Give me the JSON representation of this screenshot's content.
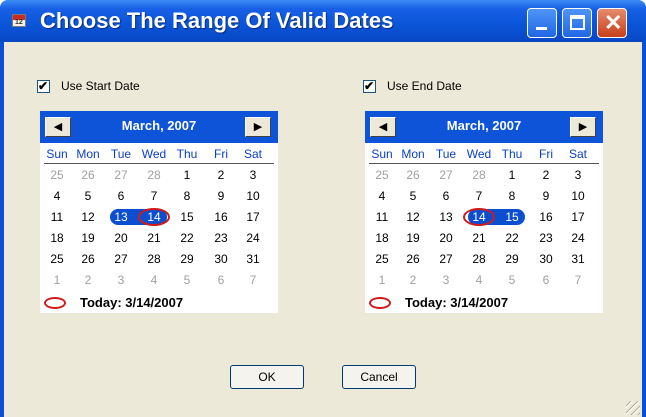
{
  "window": {
    "title": "Choose The Range Of Valid Dates",
    "title_icon": "calendar-icon",
    "controls": [
      "minimize-icon",
      "maximize-icon",
      "close-icon"
    ]
  },
  "start": {
    "checkbox_label": "Use Start Date",
    "checked": true,
    "check_glyph": "✔",
    "prev": "◀",
    "next": "▶",
    "month": "March, 2007",
    "dow": [
      "Sun",
      "Mon",
      "Tue",
      "Wed",
      "Thu",
      "Fri",
      "Sat"
    ],
    "weeks": [
      [
        "25",
        "26",
        "27",
        "28",
        "1",
        "2",
        "3"
      ],
      [
        "4",
        "5",
        "6",
        "7",
        "8",
        "9",
        "10"
      ],
      [
        "11",
        "12",
        "13",
        "14",
        "15",
        "16",
        "17"
      ],
      [
        "18",
        "19",
        "20",
        "21",
        "22",
        "23",
        "24"
      ],
      [
        "25",
        "26",
        "27",
        "28",
        "29",
        "30",
        "31"
      ],
      [
        "1",
        "2",
        "3",
        "4",
        "5",
        "6",
        "7"
      ]
    ],
    "selected": [
      "13",
      "14"
    ],
    "today_label": "Today: 3/14/2007"
  },
  "end": {
    "checkbox_label": "Use End Date",
    "checked": true,
    "check_glyph": "✔",
    "prev": "◀",
    "next": "▶",
    "month": "March, 2007",
    "dow": [
      "Sun",
      "Mon",
      "Tue",
      "Wed",
      "Thu",
      "Fri",
      "Sat"
    ],
    "weeks": [
      [
        "25",
        "26",
        "27",
        "28",
        "1",
        "2",
        "3"
      ],
      [
        "4",
        "5",
        "6",
        "7",
        "8",
        "9",
        "10"
      ],
      [
        "11",
        "12",
        "13",
        "14",
        "15",
        "16",
        "17"
      ],
      [
        "18",
        "19",
        "20",
        "21",
        "22",
        "23",
        "24"
      ],
      [
        "25",
        "26",
        "27",
        "28",
        "29",
        "30",
        "31"
      ],
      [
        "1",
        "2",
        "3",
        "4",
        "5",
        "6",
        "7"
      ]
    ],
    "selected": [
      "14",
      "15"
    ],
    "today_label": "Today: 3/14/2007"
  },
  "buttons": {
    "ok": "OK",
    "cancel": "Cancel"
  },
  "colors": {
    "title_bar": "#0a54d8",
    "calendar_header": "#0d54d8",
    "selection": "#0c4ed0",
    "today_circle": "#d21a1a",
    "dialog_bg": "#ece9d8"
  }
}
